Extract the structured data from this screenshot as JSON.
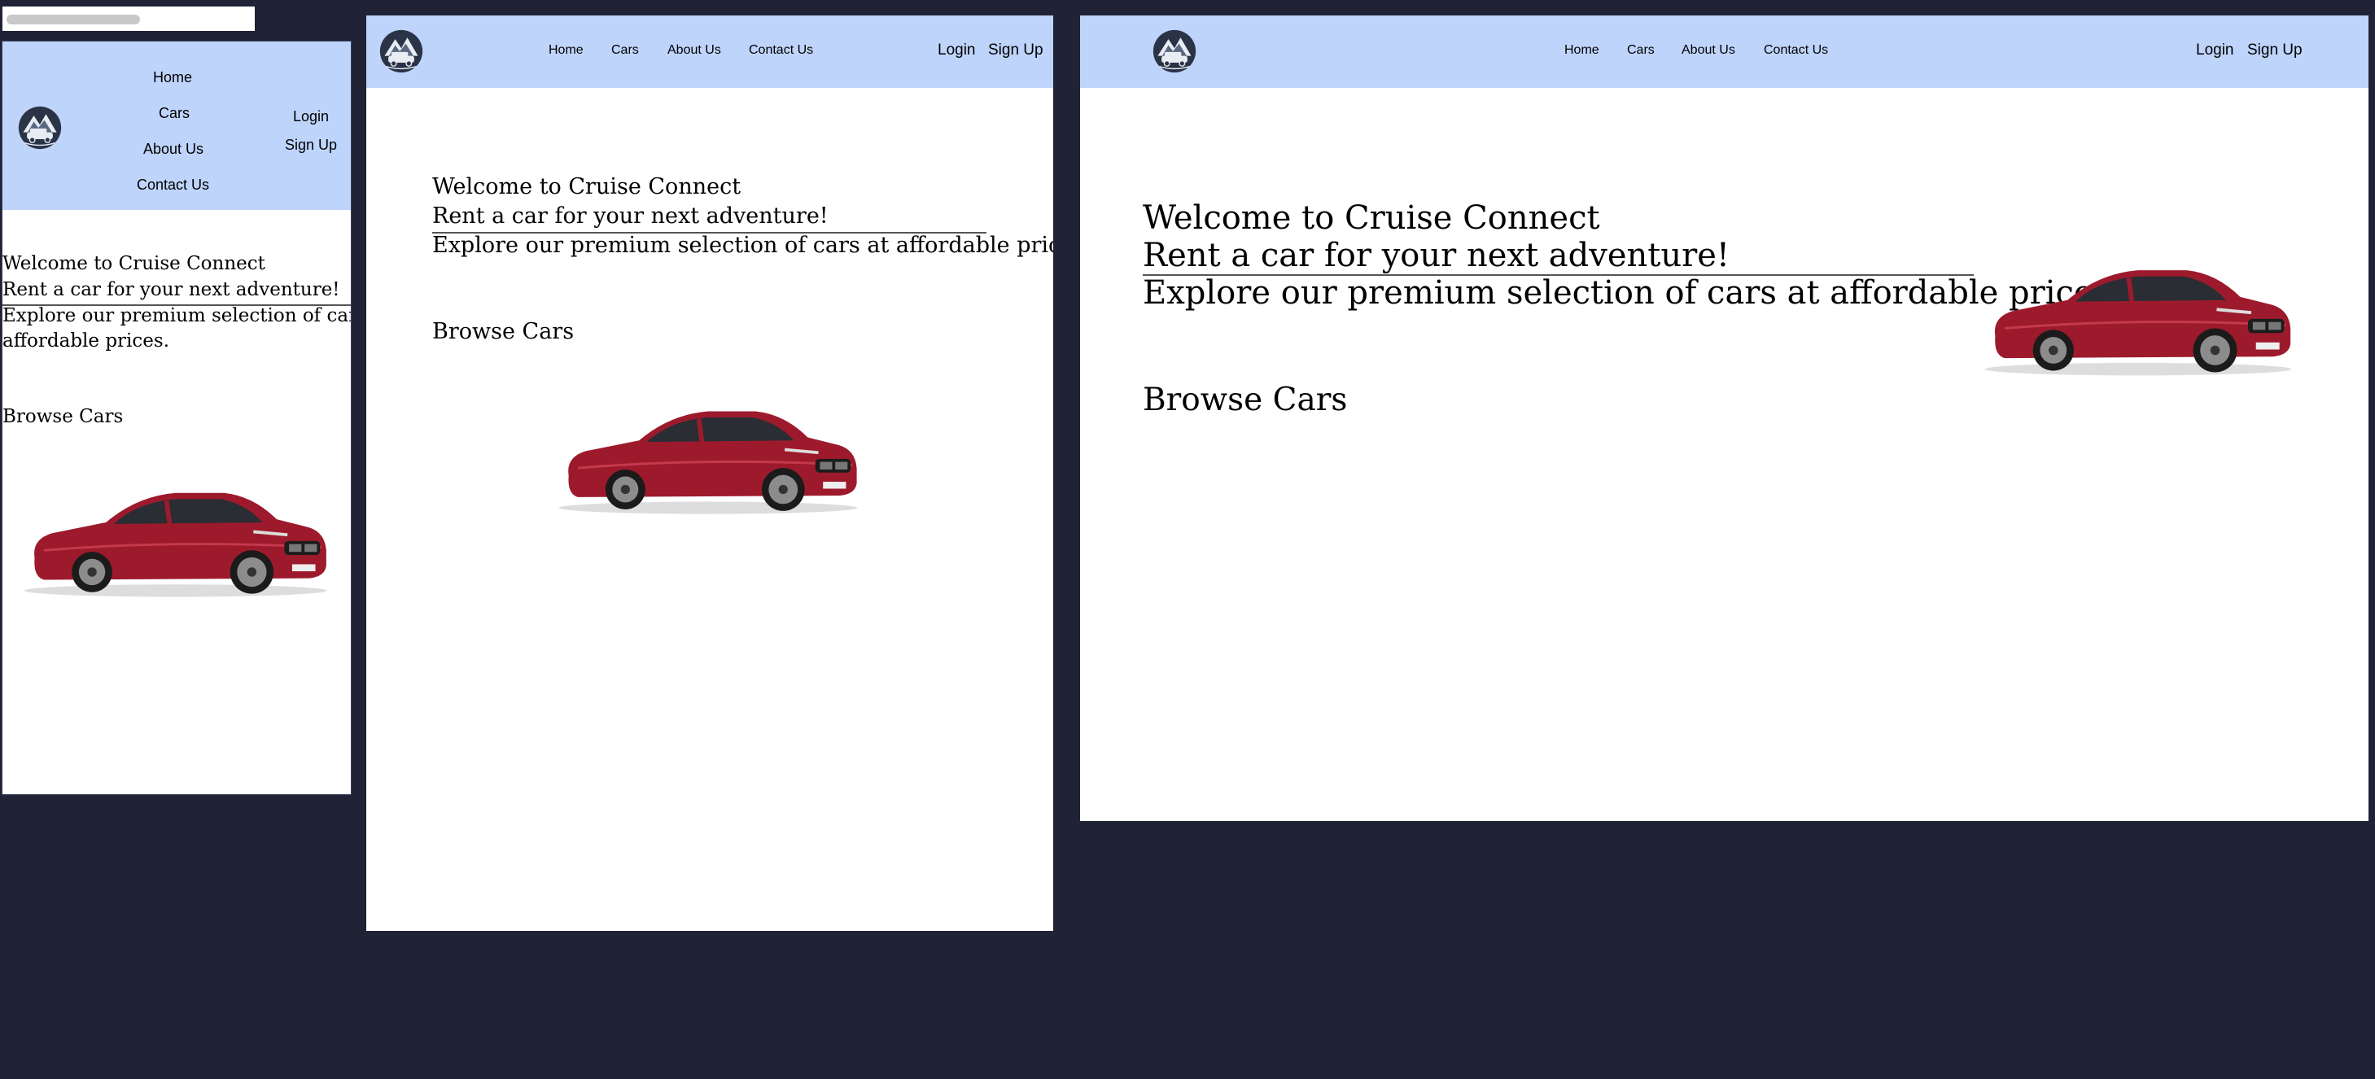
{
  "brand": {
    "logo_icon": "mountain-car-logo-icon",
    "nav_bg": "#bfd4fb",
    "page_bg": "#1f2335"
  },
  "nav": {
    "links": [
      "Home",
      "Cars",
      "About Us",
      "Contact Us"
    ],
    "login": "Login",
    "signup": "Sign Up"
  },
  "hero": {
    "welcome": "Welcome to Cruise Connect",
    "tagline": "Rent a car for your next adventure!",
    "description": "Explore our premium selection of cars at affordable prices.",
    "browse": "Browse Cars",
    "car_image": "red-sedan-car-image"
  },
  "mobile": {
    "description_line1": "Explore our premium selection of cars at",
    "description_line2": "affordable prices."
  }
}
